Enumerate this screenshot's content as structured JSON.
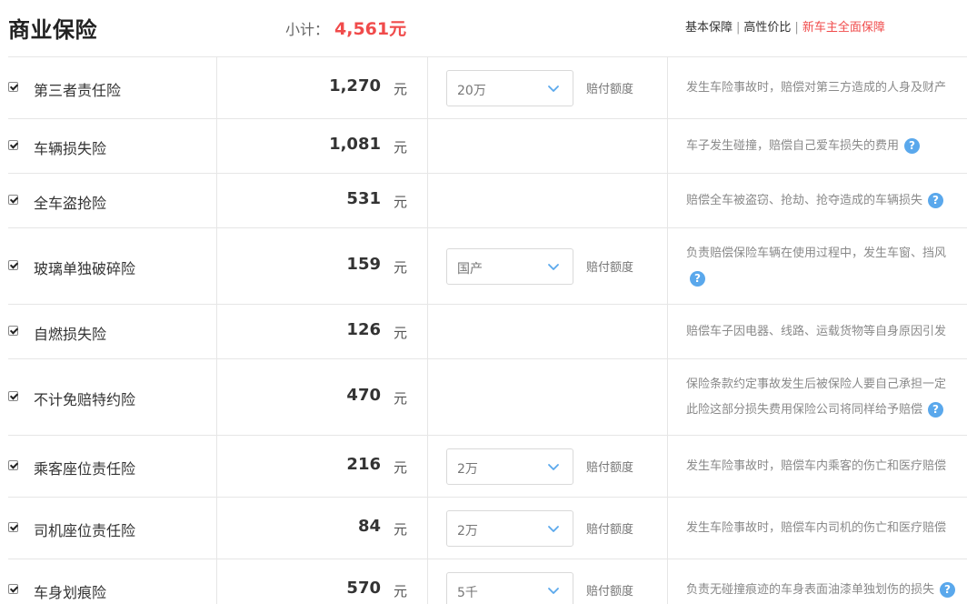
{
  "header": {
    "title": "商业保险",
    "subtotal_label": "小计：",
    "subtotal_amount": "4,561元",
    "plans": [
      "基本保障",
      "高性价比",
      "新车主全面保障"
    ]
  },
  "payout_label": "赔付额度",
  "unit": "元",
  "rows": [
    {
      "name": "第三者责任险",
      "price": "1,270",
      "select": "20万",
      "desc1": "发生车险事故时，赔偿对第三方造成的人身及财产",
      "desc2": ""
    },
    {
      "name": "车辆损失险",
      "price": "1,081",
      "select": "",
      "desc1": "车子发生碰撞，赔偿自己爱车损失的费用",
      "desc2": ""
    },
    {
      "name": "全车盗抢险",
      "price": "531",
      "select": "",
      "desc1": "赔偿全车被盗窃、抢劫、抢夺造成的车辆损失",
      "desc2": ""
    },
    {
      "name": "玻璃单独破碎险",
      "price": "159",
      "select": "国产",
      "desc1": "负责赔偿保险车辆在使用过程中，发生车窗、挡风",
      "desc2": ""
    },
    {
      "name": "自燃损失险",
      "price": "126",
      "select": "",
      "desc1": "赔偿车子因电器、线路、运载货物等自身原因引发",
      "desc2": ""
    },
    {
      "name": "不计免赔特约险",
      "price": "470",
      "select": "",
      "desc1": "保险条款约定事故发生后被保险人要自己承担一定",
      "desc2": "此险这部分损失费用保险公司将同样给予赔偿"
    },
    {
      "name": "乘客座位责任险",
      "price": "216",
      "select": "2万",
      "desc1": "发生车险事故时，赔偿车内乘客的伤亡和医疗赔偿",
      "desc2": ""
    },
    {
      "name": "司机座位责任险",
      "price": "84",
      "select": "2万",
      "desc1": "发生车险事故时，赔偿车内司机的伤亡和医疗赔偿",
      "desc2": ""
    },
    {
      "name": "车身划痕险",
      "price": "570",
      "select": "5千",
      "desc1": "负责无碰撞痕迹的车身表面油漆单独划伤的损失",
      "desc2": ""
    }
  ],
  "icons": {
    "checkbox": "checkmark-icon",
    "chevron": "chevron-down-icon",
    "help": "question-mark-icon"
  },
  "colors": {
    "accent": "#f04b4b",
    "help": "#5aa8ec"
  }
}
